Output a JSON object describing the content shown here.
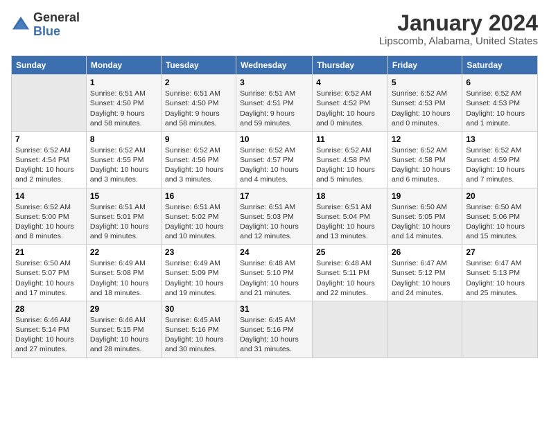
{
  "logo": {
    "text_general": "General",
    "text_blue": "Blue"
  },
  "title": "January 2024",
  "subtitle": "Lipscomb, Alabama, United States",
  "days_of_week": [
    "Sunday",
    "Monday",
    "Tuesday",
    "Wednesday",
    "Thursday",
    "Friday",
    "Saturday"
  ],
  "weeks": [
    [
      {
        "day": "",
        "info": ""
      },
      {
        "day": "1",
        "info": "Sunrise: 6:51 AM\nSunset: 4:50 PM\nDaylight: 9 hours\nand 58 minutes."
      },
      {
        "day": "2",
        "info": "Sunrise: 6:51 AM\nSunset: 4:50 PM\nDaylight: 9 hours\nand 58 minutes."
      },
      {
        "day": "3",
        "info": "Sunrise: 6:51 AM\nSunset: 4:51 PM\nDaylight: 9 hours\nand 59 minutes."
      },
      {
        "day": "4",
        "info": "Sunrise: 6:52 AM\nSunset: 4:52 PM\nDaylight: 10 hours\nand 0 minutes."
      },
      {
        "day": "5",
        "info": "Sunrise: 6:52 AM\nSunset: 4:53 PM\nDaylight: 10 hours\nand 0 minutes."
      },
      {
        "day": "6",
        "info": "Sunrise: 6:52 AM\nSunset: 4:53 PM\nDaylight: 10 hours\nand 1 minute."
      }
    ],
    [
      {
        "day": "7",
        "info": "Sunrise: 6:52 AM\nSunset: 4:54 PM\nDaylight: 10 hours\nand 2 minutes."
      },
      {
        "day": "8",
        "info": "Sunrise: 6:52 AM\nSunset: 4:55 PM\nDaylight: 10 hours\nand 3 minutes."
      },
      {
        "day": "9",
        "info": "Sunrise: 6:52 AM\nSunset: 4:56 PM\nDaylight: 10 hours\nand 3 minutes."
      },
      {
        "day": "10",
        "info": "Sunrise: 6:52 AM\nSunset: 4:57 PM\nDaylight: 10 hours\nand 4 minutes."
      },
      {
        "day": "11",
        "info": "Sunrise: 6:52 AM\nSunset: 4:58 PM\nDaylight: 10 hours\nand 5 minutes."
      },
      {
        "day": "12",
        "info": "Sunrise: 6:52 AM\nSunset: 4:58 PM\nDaylight: 10 hours\nand 6 minutes."
      },
      {
        "day": "13",
        "info": "Sunrise: 6:52 AM\nSunset: 4:59 PM\nDaylight: 10 hours\nand 7 minutes."
      }
    ],
    [
      {
        "day": "14",
        "info": "Sunrise: 6:52 AM\nSunset: 5:00 PM\nDaylight: 10 hours\nand 8 minutes."
      },
      {
        "day": "15",
        "info": "Sunrise: 6:51 AM\nSunset: 5:01 PM\nDaylight: 10 hours\nand 9 minutes."
      },
      {
        "day": "16",
        "info": "Sunrise: 6:51 AM\nSunset: 5:02 PM\nDaylight: 10 hours\nand 10 minutes."
      },
      {
        "day": "17",
        "info": "Sunrise: 6:51 AM\nSunset: 5:03 PM\nDaylight: 10 hours\nand 12 minutes."
      },
      {
        "day": "18",
        "info": "Sunrise: 6:51 AM\nSunset: 5:04 PM\nDaylight: 10 hours\nand 13 minutes."
      },
      {
        "day": "19",
        "info": "Sunrise: 6:50 AM\nSunset: 5:05 PM\nDaylight: 10 hours\nand 14 minutes."
      },
      {
        "day": "20",
        "info": "Sunrise: 6:50 AM\nSunset: 5:06 PM\nDaylight: 10 hours\nand 15 minutes."
      }
    ],
    [
      {
        "day": "21",
        "info": "Sunrise: 6:50 AM\nSunset: 5:07 PM\nDaylight: 10 hours\nand 17 minutes."
      },
      {
        "day": "22",
        "info": "Sunrise: 6:49 AM\nSunset: 5:08 PM\nDaylight: 10 hours\nand 18 minutes."
      },
      {
        "day": "23",
        "info": "Sunrise: 6:49 AM\nSunset: 5:09 PM\nDaylight: 10 hours\nand 19 minutes."
      },
      {
        "day": "24",
        "info": "Sunrise: 6:48 AM\nSunset: 5:10 PM\nDaylight: 10 hours\nand 21 minutes."
      },
      {
        "day": "25",
        "info": "Sunrise: 6:48 AM\nSunset: 5:11 PM\nDaylight: 10 hours\nand 22 minutes."
      },
      {
        "day": "26",
        "info": "Sunrise: 6:47 AM\nSunset: 5:12 PM\nDaylight: 10 hours\nand 24 minutes."
      },
      {
        "day": "27",
        "info": "Sunrise: 6:47 AM\nSunset: 5:13 PM\nDaylight: 10 hours\nand 25 minutes."
      }
    ],
    [
      {
        "day": "28",
        "info": "Sunrise: 6:46 AM\nSunset: 5:14 PM\nDaylight: 10 hours\nand 27 minutes."
      },
      {
        "day": "29",
        "info": "Sunrise: 6:46 AM\nSunset: 5:15 PM\nDaylight: 10 hours\nand 28 minutes."
      },
      {
        "day": "30",
        "info": "Sunrise: 6:45 AM\nSunset: 5:16 PM\nDaylight: 10 hours\nand 30 minutes."
      },
      {
        "day": "31",
        "info": "Sunrise: 6:45 AM\nSunset: 5:16 PM\nDaylight: 10 hours\nand 31 minutes."
      },
      {
        "day": "",
        "info": ""
      },
      {
        "day": "",
        "info": ""
      },
      {
        "day": "",
        "info": ""
      }
    ]
  ]
}
